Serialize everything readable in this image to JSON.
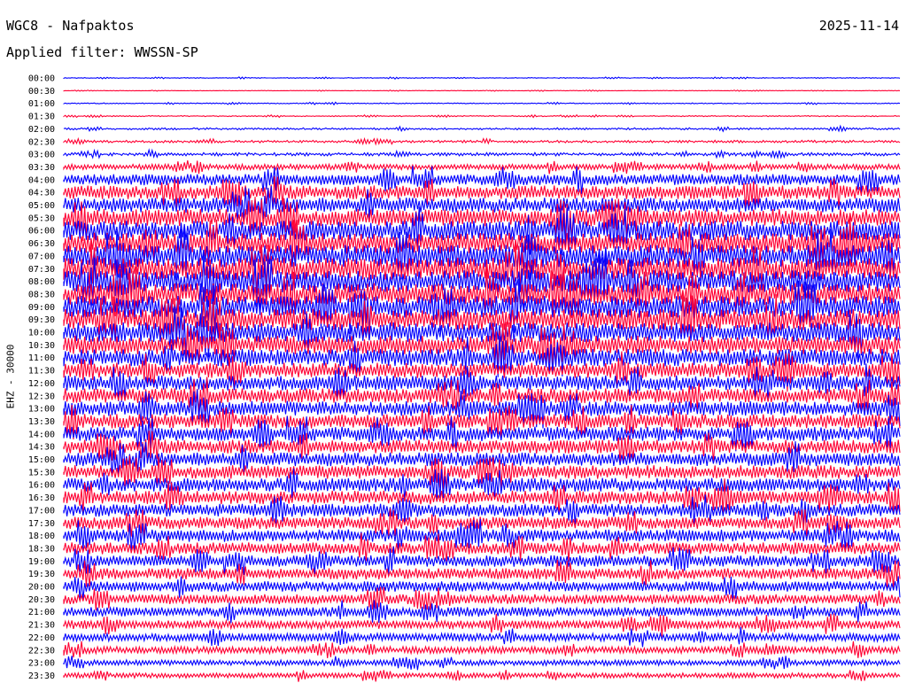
{
  "header": {
    "title": "WGC8 - Nafpaktos",
    "date": "2025-11-14",
    "filter": "Applied filter: WWSSN-SP",
    "channel": "EHZ - 30000"
  },
  "colors": {
    "blue": "#0000ff",
    "red": "#ff0033"
  },
  "chart_data": {
    "type": "line",
    "title": "WGC8 - Nafpaktos",
    "ylabel": "EHZ - 30000",
    "categories": [
      "00:00",
      "00:30",
      "01:00",
      "01:30",
      "02:00",
      "02:30",
      "03:00",
      "03:30",
      "04:00",
      "04:30",
      "05:00",
      "05:30",
      "06:00",
      "06:30",
      "07:00",
      "07:30",
      "08:00",
      "08:30",
      "09:00",
      "09:30",
      "10:00",
      "10:30",
      "11:00",
      "11:30",
      "12:00",
      "12:30",
      "13:00",
      "13:30",
      "14:00",
      "14:30",
      "15:00",
      "15:30",
      "16:00",
      "16:30",
      "17:00",
      "17:30",
      "18:00",
      "18:30",
      "19:00",
      "19:30",
      "20:00",
      "20:30",
      "21:00",
      "21:30",
      "22:00",
      "22:30",
      "23:00",
      "23:30"
    ],
    "values": [
      0.03,
      0.02,
      0.04,
      0.04,
      0.08,
      0.1,
      0.13,
      0.22,
      0.45,
      0.55,
      0.6,
      0.7,
      0.8,
      0.85,
      0.9,
      0.9,
      0.9,
      0.88,
      0.88,
      0.85,
      0.8,
      0.75,
      0.7,
      0.62,
      0.6,
      0.6,
      0.6,
      0.58,
      0.58,
      0.55,
      0.55,
      0.55,
      0.55,
      0.55,
      0.52,
      0.5,
      0.5,
      0.48,
      0.46,
      0.45,
      0.42,
      0.4,
      0.38,
      0.35,
      0.32,
      0.28,
      0.22,
      0.2
    ],
    "series": [
      {
        "color": "blue"
      },
      {
        "color": "red"
      }
    ],
    "grid": false
  }
}
